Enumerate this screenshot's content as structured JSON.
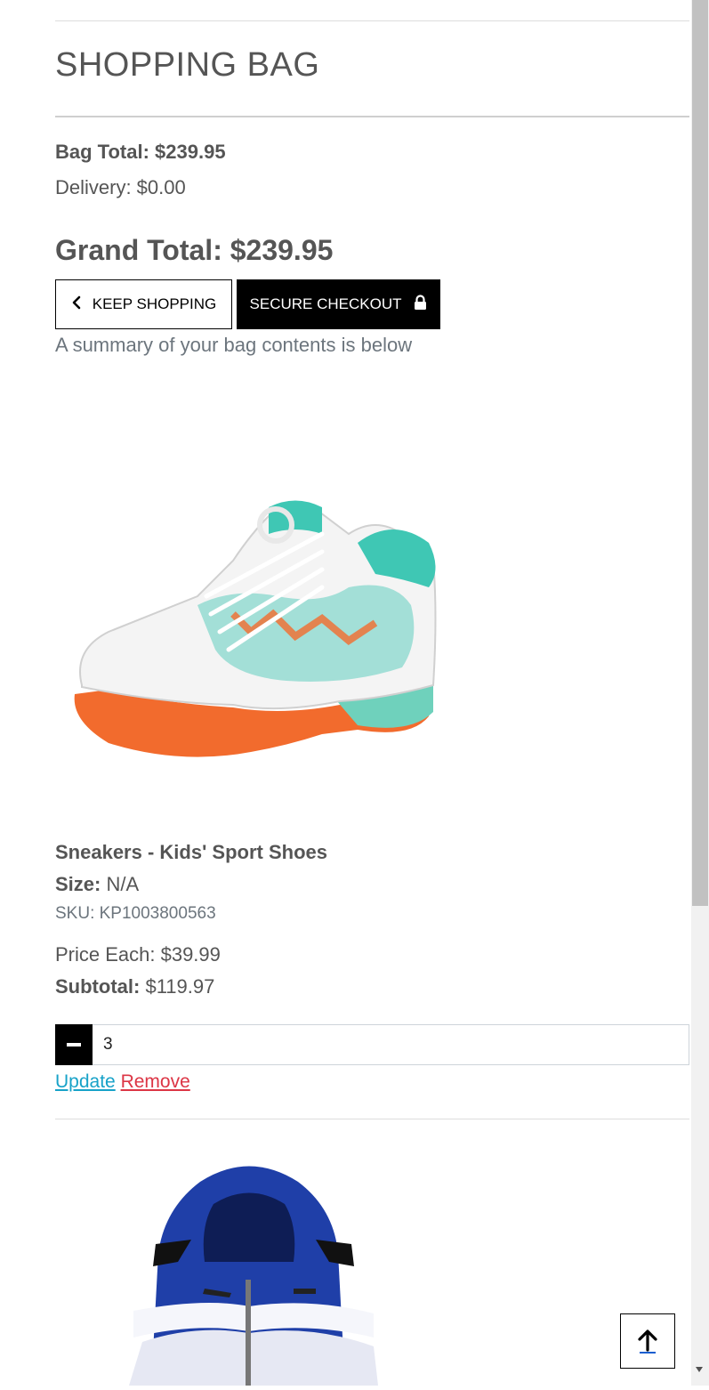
{
  "page": {
    "title": "SHOPPING BAG"
  },
  "totals": {
    "bag_total": "Bag Total: $239.95",
    "delivery": "Delivery: $0.00",
    "grand_total": "Grand Total: $239.95"
  },
  "buttons": {
    "keep_shopping": "KEEP SHOPPING",
    "secure_checkout": "SECURE CHECKOUT"
  },
  "summary_text": "A summary of your bag contents is below",
  "items": [
    {
      "name": "Sneakers - Kids' Sport Shoes",
      "size_label": "Size:",
      "size_value": "N/A",
      "sku": "SKU: KP1003800563",
      "price_each": "Price Each: $39.99",
      "subtotal_label": "Subtotal:",
      "subtotal_value": "$119.97",
      "quantity": "3",
      "update_label": "Update",
      "remove_label": "Remove"
    }
  ],
  "icons": {
    "keep_shopping": "chevron-left-icon",
    "secure_checkout": "lock-icon",
    "qty_decrement": "minus-icon",
    "back_to_top": "arrow-up-icon"
  },
  "colors": {
    "primary_button": "#000000",
    "update_link": "#17a2c8",
    "remove_link": "#dc3545",
    "muted_text": "#6c757d"
  }
}
